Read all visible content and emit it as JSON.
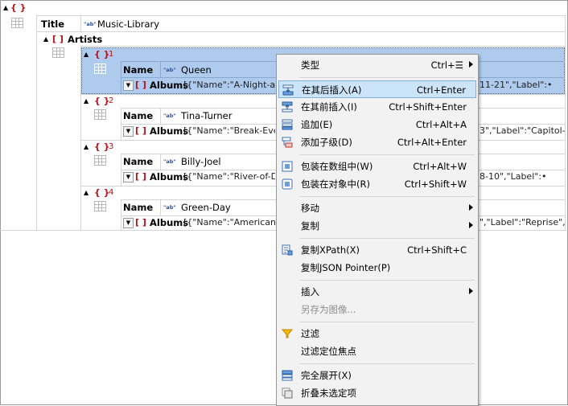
{
  "tree": {
    "root_brace": "{ }",
    "title_key": "Title",
    "title_value": "Music-Library",
    "artists_bracket": "[ ]",
    "artists_key": "Artists",
    "type_badge": "\"ab\"",
    "albums_bracket": "[ ]",
    "items": [
      {
        "index": "1",
        "name_key": "Name",
        "name_value": "Queen",
        "albums_key": "Albums",
        "albums_left": "[{\"Name\":\"A-Night-at",
        "albums_right": "11-21\",\"Label\":•"
      },
      {
        "index": "2",
        "name_key": "Name",
        "name_value": "Tina-Turner",
        "albums_key": "Albums",
        "albums_left": "[{\"Name\":\"Break-Ever",
        "albums_right": "3\",\"Label\":\"Capitol-•"
      },
      {
        "index": "3",
        "name_key": "Name",
        "name_value": "Billy-Joel",
        "albums_key": "Albums",
        "albums_left": "[{\"Name\":\"River-of-D",
        "albums_right": "8-10\",\"Label\":•"
      },
      {
        "index": "4",
        "name_key": "Name",
        "name_value": "Green-Day",
        "albums_key": "Albums",
        "albums_left": "[{\"Name\":\"American",
        "albums_right": "\",\"Label\":\"Reprise\",•"
      }
    ]
  },
  "context_menu": {
    "items": [
      {
        "label": "类型",
        "shortcut": "Ctrl+☰",
        "submenu": true,
        "icon": ""
      },
      {
        "label": "在其后插入(A)",
        "shortcut": "Ctrl+Enter",
        "highlighted": true,
        "icon": "insert-after-icon"
      },
      {
        "label": "在其前插入(I)",
        "shortcut": "Ctrl+Shift+Enter",
        "icon": "insert-before-icon"
      },
      {
        "label": "追加(E)",
        "shortcut": "Ctrl+Alt+A",
        "icon": "append-icon"
      },
      {
        "label": "添加子级(D)",
        "shortcut": "Ctrl+Alt+Enter",
        "icon": "add-child-icon"
      },
      {
        "label": "包装在数组中(W)",
        "shortcut": "Ctrl+Alt+W",
        "icon": "wrap-array-icon"
      },
      {
        "label": "包装在对象中(R)",
        "shortcut": "Ctrl+Shift+W",
        "icon": "wrap-object-icon"
      },
      {
        "label": "移动",
        "submenu": true,
        "icon": ""
      },
      {
        "label": "复制",
        "submenu": true,
        "icon": ""
      },
      {
        "label": "复制XPath(X)",
        "shortcut": "Ctrl+Shift+C",
        "icon": "copy-xpath-icon"
      },
      {
        "label": "复制JSON Pointer(P)",
        "icon": ""
      },
      {
        "label": "插入",
        "submenu": true,
        "icon": ""
      },
      {
        "label": "另存为图像...",
        "disabled": true,
        "icon": ""
      },
      {
        "label": "过滤",
        "icon": "filter-icon"
      },
      {
        "label": "过滤定位焦点",
        "icon": ""
      },
      {
        "label": "完全展开(X)",
        "icon": "expand-all-icon"
      },
      {
        "label": "折叠未选定项",
        "icon": "collapse-unselected-icon"
      }
    ]
  },
  "colors": {
    "selection_bg": "#aecbee",
    "highlight_bg": "#cce4f7",
    "brace_red": "#b5121b",
    "menu_bg": "#f2f2f2"
  }
}
